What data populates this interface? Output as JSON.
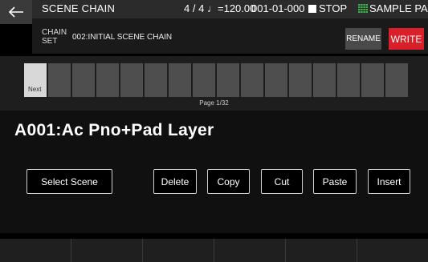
{
  "header": {
    "title": "SCENE CHAIN",
    "time_sig": "4 / 4",
    "tempo": "♩=120.00",
    "position": "001-01-000",
    "transport": "STOP",
    "mode": "SAMPLE PAD"
  },
  "chain": {
    "label_line1": "CHAIN",
    "label_line2": "SET",
    "name": "002:INITIAL SCENE CHAIN",
    "rename_label": "RENAME",
    "write_label": "WRITE"
  },
  "strip": {
    "active_label": "Next",
    "slot_count": 16,
    "page": "Page 1/32"
  },
  "scene": {
    "name": "A001:Ac Pno+Pad Layer"
  },
  "buttons": {
    "select_scene": "Select Scene",
    "delete": "Delete",
    "copy": "Copy",
    "cut": "Cut",
    "paste": "Paste",
    "insert": "Insert"
  },
  "colors": {
    "write": "#d9202a",
    "sample_pad_icon": "#3cb44b"
  },
  "icons": {
    "back": "back-arrow-icon",
    "stop": "stop-square-icon",
    "pad_grid": "pad-grid-icon"
  }
}
